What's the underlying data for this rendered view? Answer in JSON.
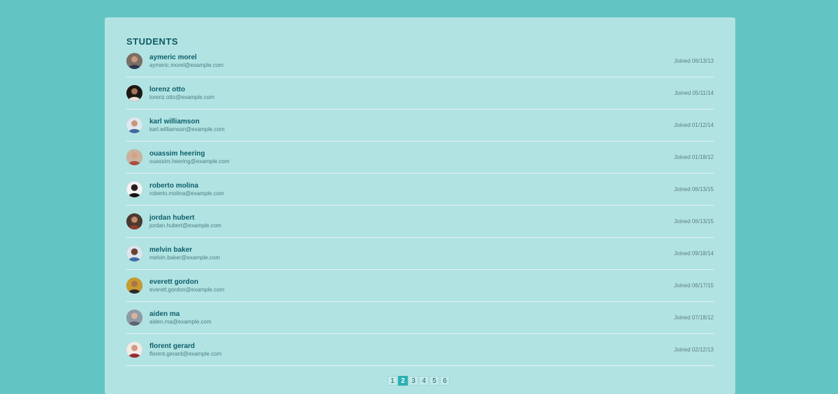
{
  "panel": {
    "title": "STUDENTS"
  },
  "students": [
    {
      "name": "aymeric morel",
      "email": "aymeric.morel@example.com",
      "joined": "Joined 06/13/13",
      "avatar": "avatar-image"
    },
    {
      "name": "lorenz otto",
      "email": "lorenz.otto@example.com",
      "joined": "Joined 05/11/14",
      "avatar": "avatar-image"
    },
    {
      "name": "karl williamson",
      "email": "karl.williamson@example.com",
      "joined": "Joined 01/12/14",
      "avatar": "avatar-image"
    },
    {
      "name": "ouassim heering",
      "email": "ouassim.heering@example.com",
      "joined": "Joined 01/18/12",
      "avatar": "avatar-image"
    },
    {
      "name": "roberto molina",
      "email": "roberto.molina@example.com",
      "joined": "Joined 06/13/15",
      "avatar": "avatar-image"
    },
    {
      "name": "jordan hubert",
      "email": "jordan.hubert@example.com",
      "joined": "Joined 06/13/15",
      "avatar": "avatar-image"
    },
    {
      "name": "melvin baker",
      "email": "melvin.baker@example.com",
      "joined": "Joined 09/18/14",
      "avatar": "avatar-image"
    },
    {
      "name": "everett gordon",
      "email": "everett.gordon@example.com",
      "joined": "Joined 06/17/15",
      "avatar": "avatar-image"
    },
    {
      "name": "aiden ma",
      "email": "aiden.ma@example.com",
      "joined": "Joined 07/18/12",
      "avatar": "avatar-image"
    },
    {
      "name": "florent gerard",
      "email": "florent.gerard@example.com",
      "joined": "Joined 02/12/13",
      "avatar": "avatar-image"
    }
  ],
  "pagination": {
    "pages": [
      "1",
      "2",
      "3",
      "4",
      "5",
      "6"
    ],
    "current": "2"
  },
  "colors": {
    "background": "#62c4c3",
    "panel": "#b2e3e3",
    "title": "#0c5a64",
    "name": "#0c5f6a",
    "active_page": "#2bb0b2"
  }
}
